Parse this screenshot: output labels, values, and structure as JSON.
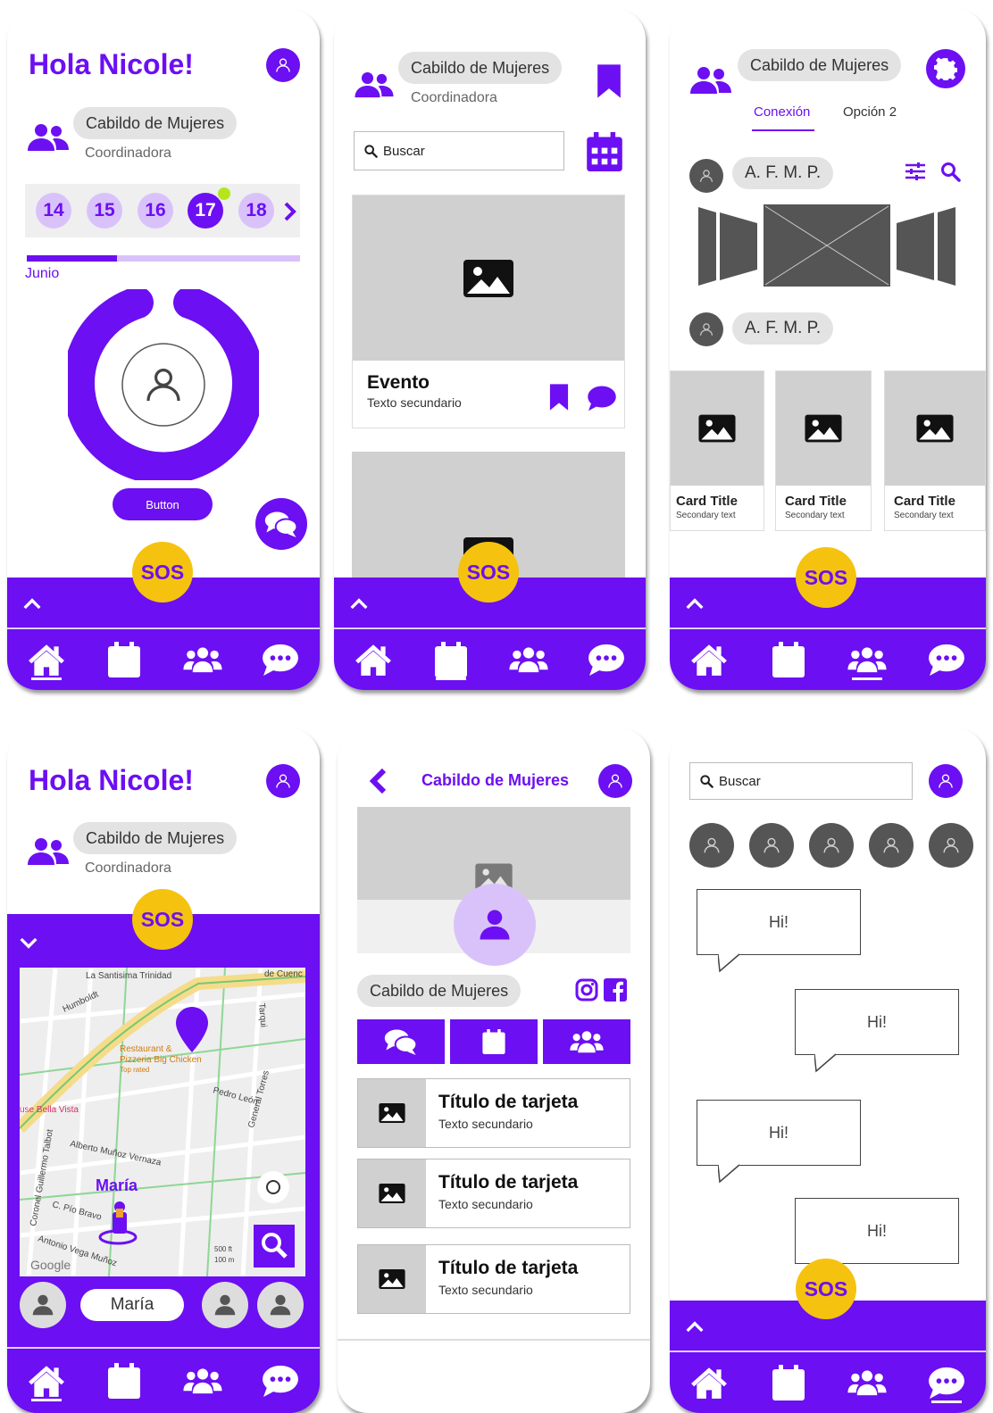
{
  "colors": {
    "primary": "#6c0ff2",
    "sos": "#f5c30f",
    "placeholder": "#d0d0d0"
  },
  "common": {
    "sos_label": "SOS",
    "org": "Cabildo de Mujeres",
    "role": "Coordinadora",
    "search_placeholder": "Buscar",
    "nav_icons": [
      "home-icon",
      "calendar-icon",
      "users-icon",
      "chat-icon"
    ]
  },
  "screen1": {
    "greeting": "Hola Nicole!",
    "days": [
      "14",
      "15",
      "16",
      "17",
      "18"
    ],
    "selected_day": "17",
    "month": "Junio",
    "month_progress": 0.33,
    "button_label": "Button"
  },
  "screen2": {
    "event_title": "Evento",
    "event_sub": "Texto secundario"
  },
  "screen3": {
    "tabs": [
      {
        "label": "Conexión",
        "active": true
      },
      {
        "label": "Opción 2",
        "active": false
      }
    ],
    "user1": "A. F. M. P.",
    "user2": "A. F. M. P.",
    "cards": [
      {
        "title": "Card Title",
        "sub": "Secondary text"
      },
      {
        "title": "Card Title",
        "sub": "Secondary text"
      },
      {
        "title": "Card Title",
        "sub": "Secondary text"
      }
    ]
  },
  "screen4": {
    "greeting": "Hola Nicole!",
    "map": {
      "labels": [
        "La Santisima Trinidad",
        "de Cuenc",
        "Humboldt",
        "Restaurant &",
        "Pizzeria Big Chicken",
        "Top rated",
        "Pedro León",
        "Tarqui",
        "use Bella Vista",
        "Alberto Muñoz Vernaza",
        "General Torres",
        "Coronel Guillermo Talbot",
        "C. Pío Bravo",
        "Antonio Vega Muñoz",
        "500 ft",
        "100 m",
        "Google"
      ],
      "person_label": "María"
    },
    "contact_name": "María"
  },
  "screen5": {
    "title": "Cabildo de Mujeres",
    "org_chip": "Cabildo de Mujeres",
    "cards": [
      {
        "title": "Título de tarjeta",
        "sub": "Texto secundario"
      },
      {
        "title": "Título de tarjeta",
        "sub": "Texto secundario"
      },
      {
        "title": "Título de tarjeta",
        "sub": "Texto secundario"
      }
    ]
  },
  "screen6": {
    "messages": [
      "Hi!",
      "Hi!",
      "Hi!",
      "Hi!"
    ]
  }
}
